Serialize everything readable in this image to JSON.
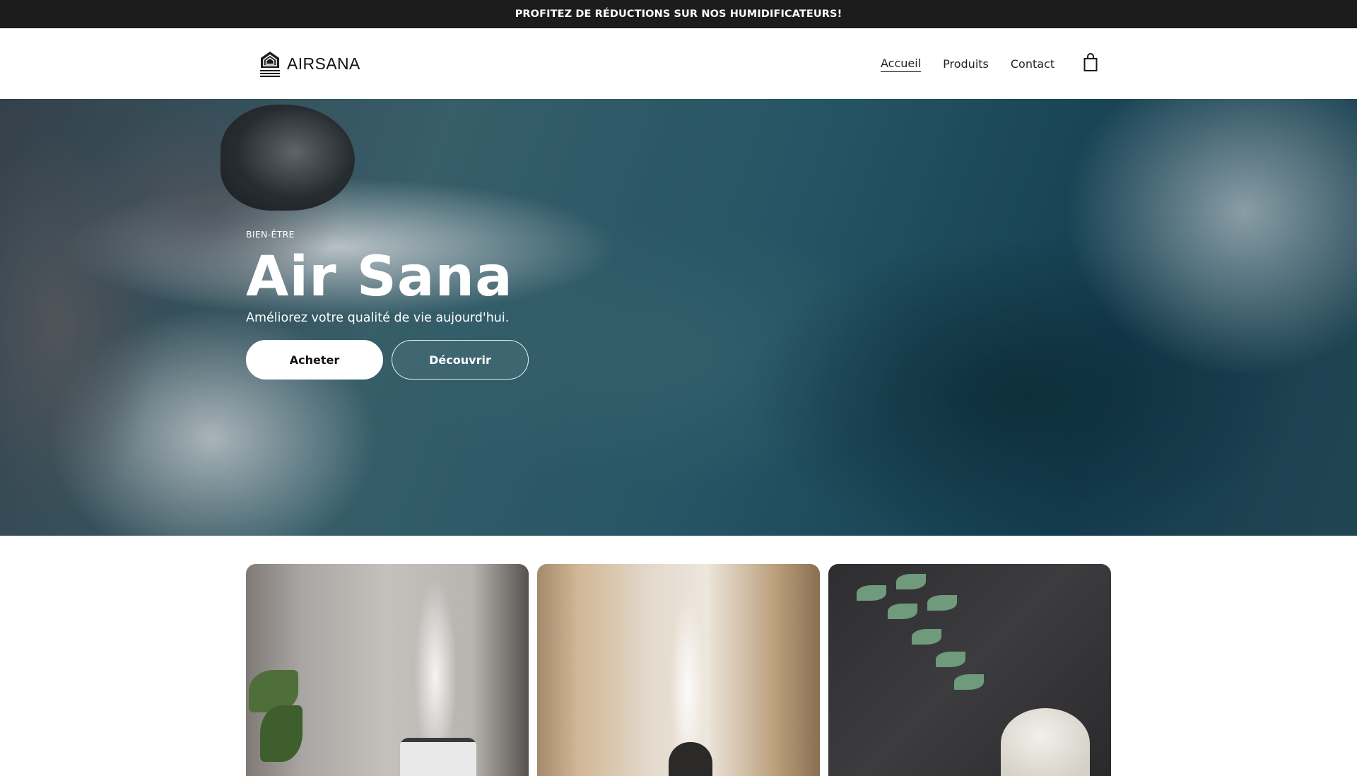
{
  "announcement": {
    "text": "PROFITEZ DE RÉDUCTIONS SUR NOS HUMIDIFICATEURS!"
  },
  "header": {
    "logo_text": "AIRSANA",
    "logo_icon": "airsana-logo-mark",
    "nav": [
      {
        "label": "Accueil",
        "active": true
      },
      {
        "label": "Produits",
        "active": false
      },
      {
        "label": "Contact",
        "active": false
      }
    ],
    "cart_icon": "shopping-bag-icon"
  },
  "hero": {
    "eyebrow": "BIEN-ÊTRE",
    "title": "Air Sana",
    "subtitle": "Améliorez votre qualité de vie aujourd'hui.",
    "primary_button": "Acheter",
    "secondary_button": "Découvrir"
  },
  "cards": [
    {
      "image": "white-humidifier-with-mist"
    },
    {
      "image": "dark-diffuser-with-pampas-grass"
    },
    {
      "image": "ceramic-diffuser-with-eucalyptus"
    }
  ],
  "colors": {
    "announcement_bg": "#1c1c1c",
    "text": "#111111",
    "button_primary_bg": "#ffffff"
  }
}
